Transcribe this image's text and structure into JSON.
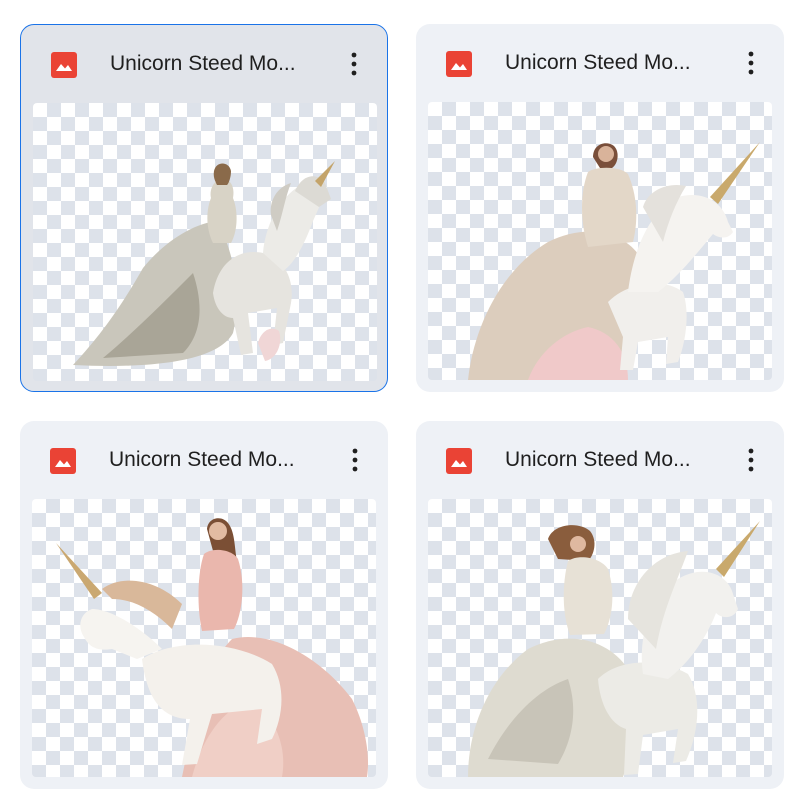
{
  "files": [
    {
      "title": "Unicorn Steed Mo...",
      "icon": "image-file-icon",
      "selected": true
    },
    {
      "title": "Unicorn Steed Mo...",
      "icon": "image-file-icon",
      "selected": false
    },
    {
      "title": "Unicorn Steed Mo...",
      "icon": "image-file-icon",
      "selected": false
    },
    {
      "title": "Unicorn Steed Mo...",
      "icon": "image-file-icon",
      "selected": false
    }
  ],
  "colors": {
    "accent": "#1a73e8",
    "icon_red": "#ea4335",
    "card_bg": "#eef1f6",
    "card_selected_bg": "#e1e4ea"
  }
}
